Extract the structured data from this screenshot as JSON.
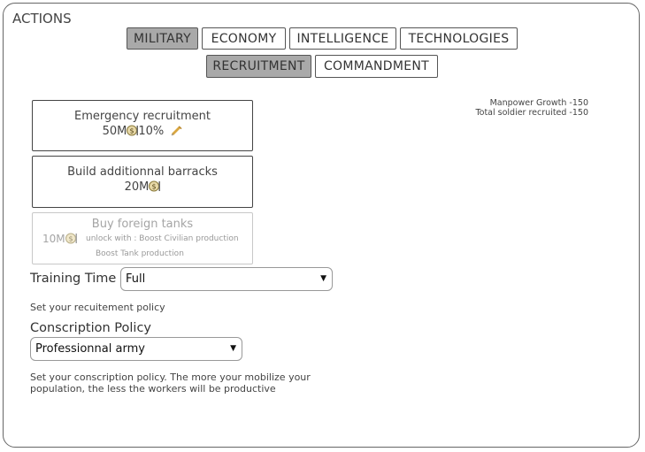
{
  "panel": {
    "title": "ACTIONS"
  },
  "tabs_primary": [
    {
      "label": "MILITARY",
      "active": true
    },
    {
      "label": "ECONOMY",
      "active": false
    },
    {
      "label": "INTELLIGENCE",
      "active": false
    },
    {
      "label": "TECHNOLOGIES",
      "active": false
    }
  ],
  "tabs_secondary": [
    {
      "label": "RECRUITMENT",
      "active": true
    },
    {
      "label": "COMMANDMENT",
      "active": false
    }
  ],
  "stats": {
    "manpower_growth": "Manpower Growth -150",
    "total_recruited": "Total soldier recruited -150"
  },
  "actions": [
    {
      "title": "Emergency recruitment",
      "cost": "50M",
      "extra": "10%",
      "extra_icon": "syringe-icon"
    },
    {
      "title": "Build additionnal barracks",
      "cost": "20M"
    },
    {
      "title": "Buy foreign tanks",
      "cost": "10M",
      "unlock": "unlock with : Boost Civilian production",
      "unlock2": "Boost Tank production"
    }
  ],
  "training": {
    "label": "Training Time",
    "value": "Full",
    "help": "Set your recuitement policy"
  },
  "conscription": {
    "label": "Conscription Policy",
    "value": "Professionnal army",
    "help_line1": "Set your conscription policy. The more your mobilize your",
    "help_line2": "population, the less the workers will be productive"
  },
  "colors": {
    "active_tab": "#a9a9a9",
    "coin": "#c8a13a",
    "disabled_text": "#a5a5a5"
  }
}
